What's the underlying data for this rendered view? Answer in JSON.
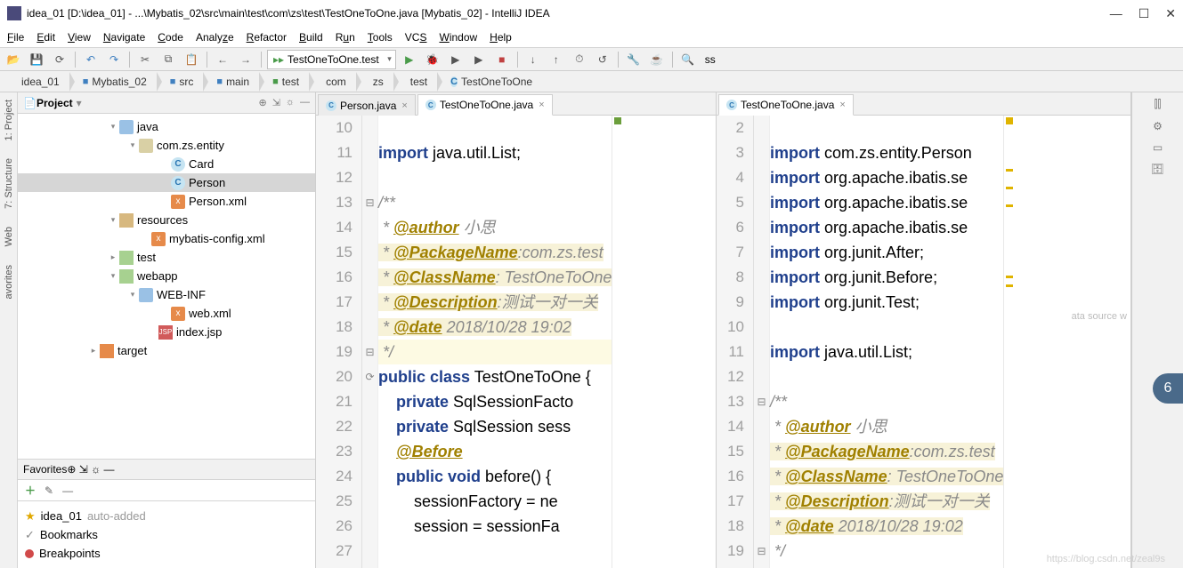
{
  "title": "idea_01 [D:\\idea_01] - ...\\Mybatis_02\\src\\main\\test\\com\\zs\\test\\TestOneToOne.java [Mybatis_02] - IntelliJ IDEA",
  "menus": [
    "File",
    "Edit",
    "View",
    "Navigate",
    "Code",
    "Analyze",
    "Refactor",
    "Build",
    "Run",
    "Tools",
    "VCS",
    "Window",
    "Help"
  ],
  "run_config": "TestOneToOne.test",
  "toolbar_ss": "ss",
  "breadcrumb": [
    {
      "icon": "folder",
      "label": "idea_01"
    },
    {
      "icon": "folder-b",
      "label": "Mybatis_02"
    },
    {
      "icon": "folder-b",
      "label": "src"
    },
    {
      "icon": "folder-b",
      "label": "main"
    },
    {
      "icon": "folder-g",
      "label": "test"
    },
    {
      "icon": "pkg",
      "label": "com"
    },
    {
      "icon": "pkg",
      "label": "zs"
    },
    {
      "icon": "pkg",
      "label": "test"
    },
    {
      "icon": "class",
      "label": "TestOneToOne"
    }
  ],
  "left_tabs": [
    "1: Project",
    "7: Structure",
    "Web",
    "avorites"
  ],
  "project_panel": "Project",
  "tree": {
    "java": "java",
    "pkg": "com.zs.entity",
    "card": "Card",
    "person": "Person",
    "person_xml": "Person.xml",
    "resources": "resources",
    "mybatis_cfg": "mybatis-config.xml",
    "test": "test",
    "webapp": "webapp",
    "webinf": "WEB-INF",
    "webxml": "web.xml",
    "indexjsp": "index.jsp",
    "target": "target"
  },
  "favorites": {
    "title": "Favorites",
    "idea01": "idea_01",
    "auto": "auto-added",
    "bookmarks": "Bookmarks",
    "breakpoints": "Breakpoints"
  },
  "tabs_left": [
    {
      "label": "Person.java",
      "active": false
    },
    {
      "label": "TestOneToOne.java",
      "active": true
    }
  ],
  "tabs_right": [
    {
      "label": "TestOneToOne.java",
      "active": true
    }
  ],
  "editor_left": {
    "start": 10,
    "lines": [
      "",
      "import java.util.List;",
      "",
      "/**",
      " * @author 小思",
      " * @PackageName:com.zs.test",
      " * @ClassName: TestOneToOne",
      " * @Description:测试一对一关",
      " * @date 2018/10/28 19:02",
      " */",
      "public class TestOneToOne {",
      "    private SqlSessionFacto",
      "    private SqlSession sess",
      "    @Before",
      "    public void before() {",
      "        sessionFactory = ne",
      "        session = sessionFa",
      ""
    ]
  },
  "editor_right": {
    "start": 2,
    "hint": "ata source w",
    "lines": [
      "",
      "import com.zs.entity.Person",
      "import org.apache.ibatis.se",
      "import org.apache.ibatis.se",
      "import org.apache.ibatis.se",
      "import org.junit.After;",
      "import org.junit.Before;",
      "import org.junit.Test;",
      "",
      "import java.util.List;",
      "",
      "/**",
      " * @author 小思",
      " * @PackageName:com.zs.test",
      " * @ClassName: TestOneToOne",
      " * @Description:测试一对一关",
      " * @date 2018/10/28 19:02",
      " */"
    ]
  },
  "badge": "6",
  "watermark": "https://blog.csdn.net/zeal9s"
}
